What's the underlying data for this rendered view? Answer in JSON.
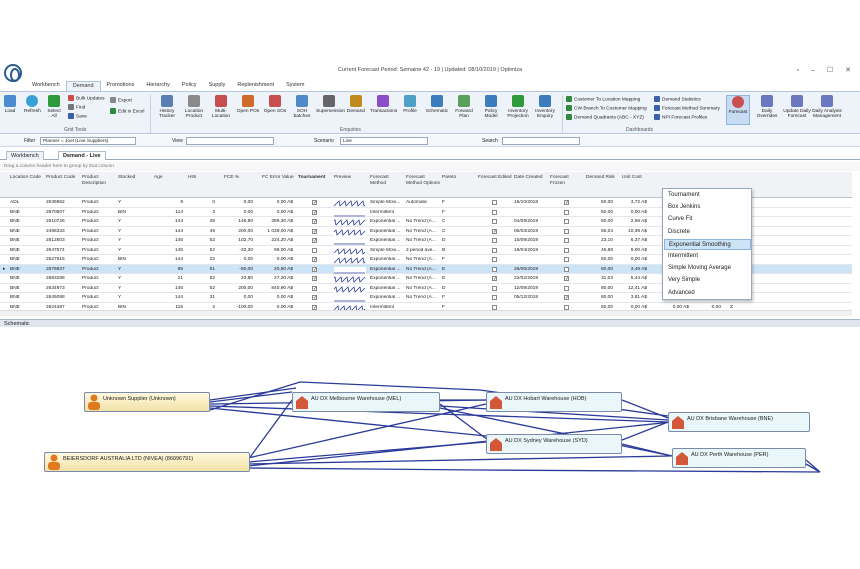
{
  "window": {
    "title": "Current Forecast Period: Semaine 42 - 19 | Updated: 08/10/2019 | Optimiza"
  },
  "tabs": [
    "Workbench",
    "Demand",
    "Promotions",
    "Hierarchy",
    "Policy",
    "Supply",
    "Replenishment",
    "System"
  ],
  "ribbon": {
    "load": "Load",
    "refresh": "Refresh",
    "select_all": "Select All",
    "bulk_updates": "Bulk Updates",
    "find": "Find",
    "save": "Save",
    "export": "Export",
    "edit_in_excel": "Edit in Excel",
    "grid_tools": "Grid Tools",
    "enquiries": [
      [
        "History",
        "Tracker"
      ],
      [
        "Location",
        "Product"
      ],
      [
        "Multi-Location",
        ""
      ],
      [
        "Open POs",
        ""
      ],
      [
        "Open SOs",
        ""
      ],
      [
        "SOH batches",
        ""
      ],
      [
        "Supersession",
        ""
      ],
      [
        "Demand",
        ""
      ],
      [
        "Transactions",
        ""
      ],
      [
        "Profile",
        ""
      ],
      [
        "Schematic",
        ""
      ],
      [
        "Forward",
        "Plan"
      ],
      [
        "Policy",
        "Model"
      ],
      [
        "Inventory",
        "Projection"
      ],
      [
        "Inventory",
        "Enquiry"
      ]
    ],
    "enquiries_label": "Enquiries",
    "links_a": [
      "Customer To Location Mapping",
      "CW Branch To Customer Mapping",
      "Demand Quadrants (ABC - XYZ)"
    ],
    "links_b": [
      "Demand Statistics",
      "Forecast Method Summary",
      "NPI Forecast Profiles"
    ],
    "dashboards": "Dashboards",
    "forecast": "Forecast",
    "right": [
      [
        "Daily",
        "Overrides"
      ],
      [
        "Update Daily",
        "Forecast"
      ],
      [
        "Daily Analysis",
        "Management"
      ]
    ]
  },
  "filter": {
    "filter_label": "Filter",
    "filter_value": "Planner = Joel (Live Suppliers)",
    "view_label": "View",
    "scenario_label": "Scenario",
    "scenario_value": "Live",
    "search_label": "Search"
  },
  "doc_tabs": [
    "Workbench",
    "Demand - Live"
  ],
  "group_hint": "Drag a column header here to group by that column",
  "columns": [
    "Location Code",
    "Product Code",
    "Product Description",
    "Stocked",
    "Age",
    "Hits",
    "FCE %",
    "FC Error Value",
    "Tournament",
    "Preview",
    "Forecast Method",
    "Forecast Method Options",
    "Pareto",
    "Forecast Edited",
    "Date Created",
    "Forecast Frozen",
    "Demand Risk",
    "Unit Cost",
    "",
    "",
    ""
  ],
  "rows": [
    [
      "ADL",
      "2636962",
      "Product",
      "Y",
      "9",
      "0",
      "0,00",
      "0,00 A$",
      true,
      "Simple Movi...",
      "Automatic",
      "F",
      false,
      "15/10/2018",
      true,
      "50,00",
      "3,72 A$",
      "",
      "",
      ""
    ],
    [
      "BNE",
      "2670507",
      "Product",
      "BIN",
      "114",
      "3",
      "0,00",
      "0,00 A$",
      true,
      "Intermittent",
      "",
      "F",
      false,
      "",
      false,
      "50,00",
      "0,00 A$",
      "",
      "",
      ""
    ],
    [
      "BNE",
      "2510726",
      "Product",
      "Y",
      "144",
      "48",
      "146,90",
      "399,30 A$",
      true,
      "Exponential ...",
      "No Trend (A...",
      "C",
      false,
      "04/09/2019",
      false,
      "50,00",
      "2,58 A$",
      "",
      "",
      ""
    ],
    [
      "BNE",
      "2496333",
      "Product",
      "Y",
      "144",
      "49",
      "200,00",
      "1 039,00 A$",
      true,
      "Exponential ...",
      "No Trend (A...",
      "C",
      true,
      "06/03/2019",
      false,
      "56,04",
      "10,39 A$",
      "",
      "",
      ""
    ],
    [
      "BNE",
      "2612503",
      "Product",
      "Y",
      "145",
      "52",
      "102,70",
      "224,20 A$",
      true,
      "Exponential ...",
      "No Trend (A...",
      "D",
      false,
      "10/09/2019",
      false,
      "23,10",
      "6,37 A$",
      "",
      "",
      ""
    ],
    [
      "BNE",
      "2647574",
      "Product",
      "Y",
      "145",
      "52",
      "-33,30",
      "99,00 A$",
      false,
      "Simple Movi...",
      "2 period ave...",
      "B",
      false,
      "18/04/2019",
      false,
      "45,88",
      "9,00 A$",
      "9,72 A$",
      "0,00",
      "Y"
    ],
    [
      "BNE",
      "2627615",
      "Product",
      "BIN",
      "144",
      "22",
      "0,00",
      "0,00 A$",
      true,
      "Exponential ...",
      "No Trend (A...",
      "F",
      false,
      "",
      false,
      "50,00",
      "0,00 A$",
      "0,00 A$",
      "0,00",
      "Y"
    ],
    [
      "BNE",
      "2676927",
      "Product",
      "Y",
      "85",
      "51",
      "-50,00",
      "20,90 A$",
      true,
      "Exponential ...",
      "No Trend (A...",
      "E",
      false,
      "26/06/2019",
      false,
      "80,00",
      "3,49 A$",
      "3,80 A$",
      "0,00",
      "Z"
    ],
    [
      "BNE",
      "2683288",
      "Product",
      "Y",
      "21",
      "52",
      "23,80",
      "27,20 A$",
      true,
      "Exponential ...",
      "No Trend (A...",
      "E",
      true,
      "22/02/2019",
      true,
      "31,03",
      "5,44 A$",
      "5,88 A$",
      "0,00",
      "Y"
    ],
    [
      "BNE",
      "2634973",
      "Product",
      "Y",
      "145",
      "52",
      "200,00",
      "840,90 A$",
      true,
      "Exponential ...",
      "No Trend (A...",
      "D",
      false,
      "12/09/2019",
      false,
      "80,00",
      "12,41 A$",
      "13,40 A$",
      "0,00",
      "Y"
    ],
    [
      "BNE",
      "2645088",
      "Product",
      "Y",
      "144",
      "31",
      "0,00",
      "0,00 A$",
      true,
      "Exponential ...",
      "No Trend (A...",
      "F",
      false,
      "05/12/2018",
      true,
      "80,00",
      "3,81 A$",
      "4,15 A$",
      "0,00",
      "Z"
    ],
    [
      "BNE",
      "2624487",
      "Product",
      "BIN",
      "115",
      "2",
      "-100,00",
      "0,00 A$",
      true,
      "Intermittent",
      "",
      "F",
      false,
      "",
      false,
      "50,00",
      "0,00 A$",
      "0,00 A$",
      "0,00",
      "Z"
    ]
  ],
  "forecast_menu": [
    "Tournament",
    "Box Jenkins",
    "Curve Fit",
    "Discrete",
    "Exponential Smoothing",
    "Intermittent",
    "Simple Moving Average",
    "Very Simple",
    "Advanced"
  ],
  "schematic": {
    "title": "Schematic",
    "suppliers": [
      "Unknown Supplier (Unknown)",
      "BEIERSDORF AUSTRALIA LTD (NIVEA) (86096791)"
    ],
    "warehouses": [
      "AU DX Melbourne Warehouse (MEL)",
      "AU DX Hobart Warehouse (HOB)",
      "AU DX Sydney Warehouse (SYD)",
      "AU DX Brisbane Warehouse (BNE)",
      "AU DX Perth Warehouse (PER)"
    ]
  },
  "colors": {
    "accent": "#2a3a99",
    "ribbon_bg": "#eef3fa",
    "highlight": "#cde3f6"
  }
}
